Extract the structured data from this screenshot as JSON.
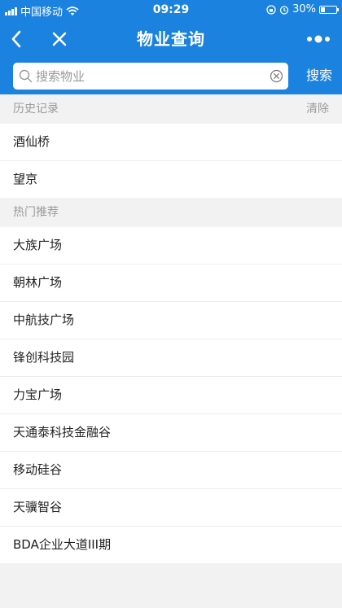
{
  "status_bar": {
    "carrier": "中国移动",
    "time": "09:29",
    "battery": "30%",
    "battery_level": 0.3
  },
  "nav": {
    "title": "物业查询"
  },
  "search": {
    "placeholder": "搜索物业",
    "value": "",
    "button_label": "搜索"
  },
  "history": {
    "title": "历史记录",
    "clear_label": "清除",
    "items": [
      "酒仙桥",
      "望京"
    ]
  },
  "hot": {
    "title": "热门推荐",
    "items": [
      "大族广场",
      "朝林广场",
      "中航技广场",
      "锋创科技园",
      "力宝广场",
      "天通泰科技金融谷",
      "移动硅谷",
      "天骥智谷",
      "BDA企业大道III期"
    ]
  },
  "icons": {
    "signal": "signal-icon",
    "wifi": "wifi-icon",
    "lock_rotation": "rotation-lock-icon",
    "alarm": "alarm-icon",
    "battery": "battery-icon",
    "back": "back-arrow-icon",
    "close": "close-icon",
    "more": "more-icon",
    "search": "search-icon",
    "clear": "clear-icon"
  },
  "colors": {
    "primary": "#1b82e0",
    "background": "#f2f2f2",
    "muted_text": "#9a9a9a"
  }
}
